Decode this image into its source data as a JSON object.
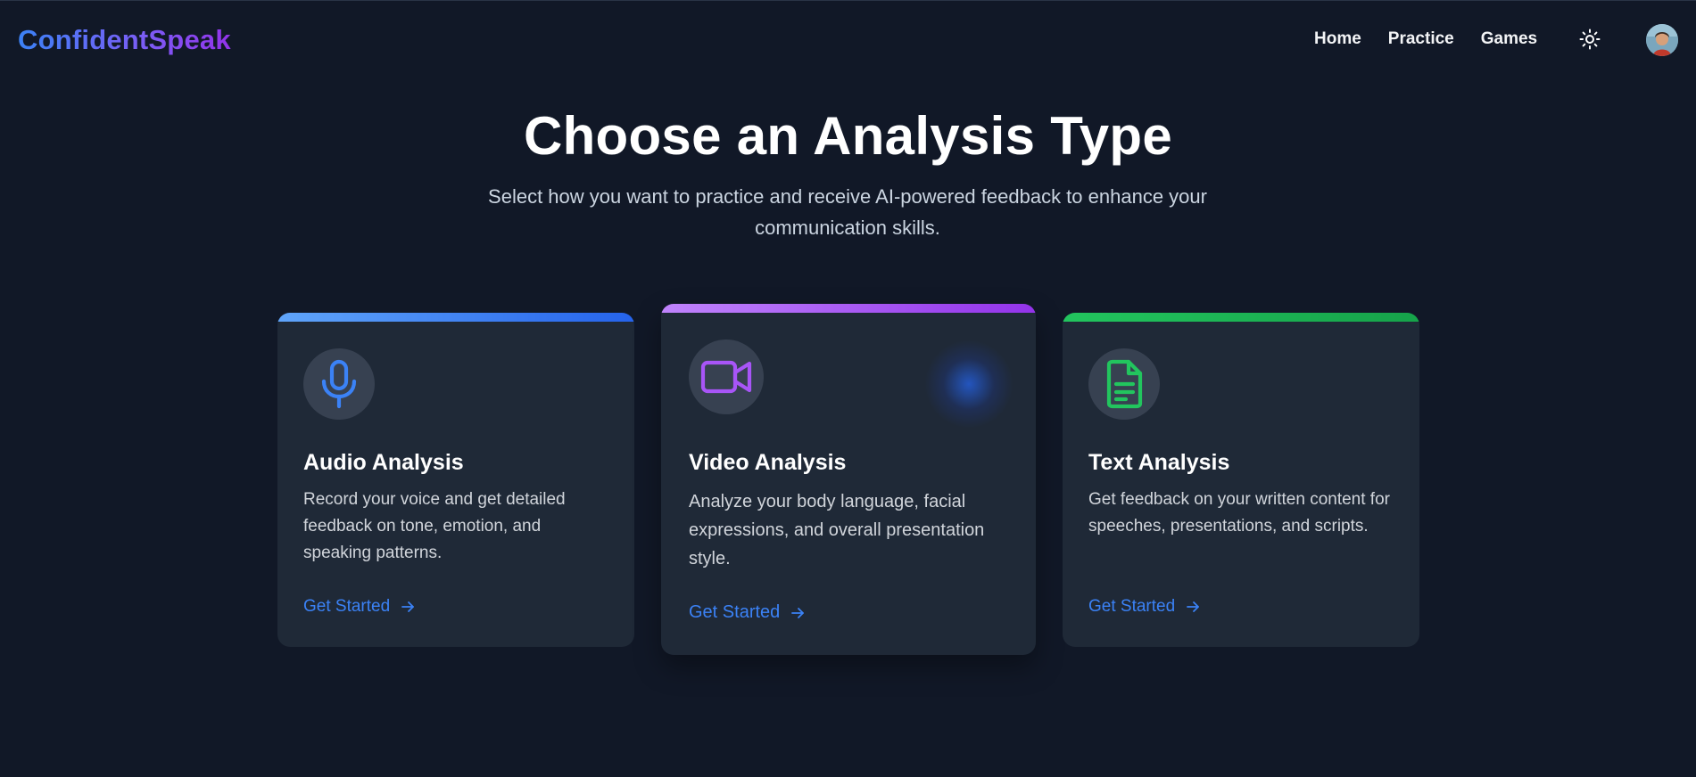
{
  "brand": {
    "name": "ConfidentSpeak"
  },
  "nav": {
    "links": [
      "Home",
      "Practice",
      "Games"
    ],
    "theme_icon": "sun-icon",
    "avatar_icon": "user-avatar"
  },
  "hero": {
    "title": "Choose an Analysis Type",
    "subtitle": "Select how you want to practice and receive AI-powered feedback to enhance your communication skills."
  },
  "cards": [
    {
      "id": "audio",
      "icon": "microphone-icon",
      "accent": "#3b82f6",
      "bar_gradient": [
        "#60a5fa",
        "#2563eb"
      ],
      "title": "Audio Analysis",
      "description": "Record your voice and get detailed feedback on tone, emotion, and speaking patterns.",
      "cta": "Get Started"
    },
    {
      "id": "video",
      "icon": "video-camera-icon",
      "accent": "#a855f7",
      "bar_gradient": [
        "#c084fc",
        "#9333ea"
      ],
      "title": "Video Analysis",
      "description": "Analyze your body language, facial expressions, and overall presentation style.",
      "cta": "Get Started"
    },
    {
      "id": "text",
      "icon": "document-icon",
      "accent": "#22c55e",
      "bar_gradient": [
        "#22c55e",
        "#16a34a"
      ],
      "title": "Text Analysis",
      "description": "Get feedback on your written content for speeches, presentations, and scripts.",
      "cta": "Get Started"
    }
  ],
  "colors": {
    "background": "#111827",
    "card": "#1f2937",
    "link": "#3b82f6"
  }
}
